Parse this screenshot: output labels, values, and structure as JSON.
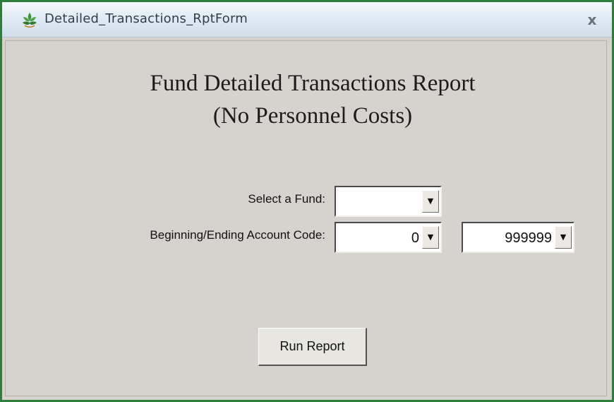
{
  "window": {
    "title": "Detailed_Transactions_RptForm",
    "close_glyph": "x",
    "icon": "flower-logo-icon"
  },
  "report": {
    "title_line1": "Fund Detailed Transactions Report",
    "title_line2": "(No Personnel Costs)"
  },
  "form": {
    "fund_label": "Select a Fund:",
    "fund_value": "",
    "account_label": "Beginning/Ending Account Code:",
    "account_begin_value": "0",
    "account_end_value": "999999",
    "dropdown_glyph": "▼"
  },
  "actions": {
    "run_label": "Run Report"
  },
  "colors": {
    "window_border": "#2e7d3a",
    "form_background": "#d6d3ce",
    "titlebar": "#dde8f2"
  }
}
